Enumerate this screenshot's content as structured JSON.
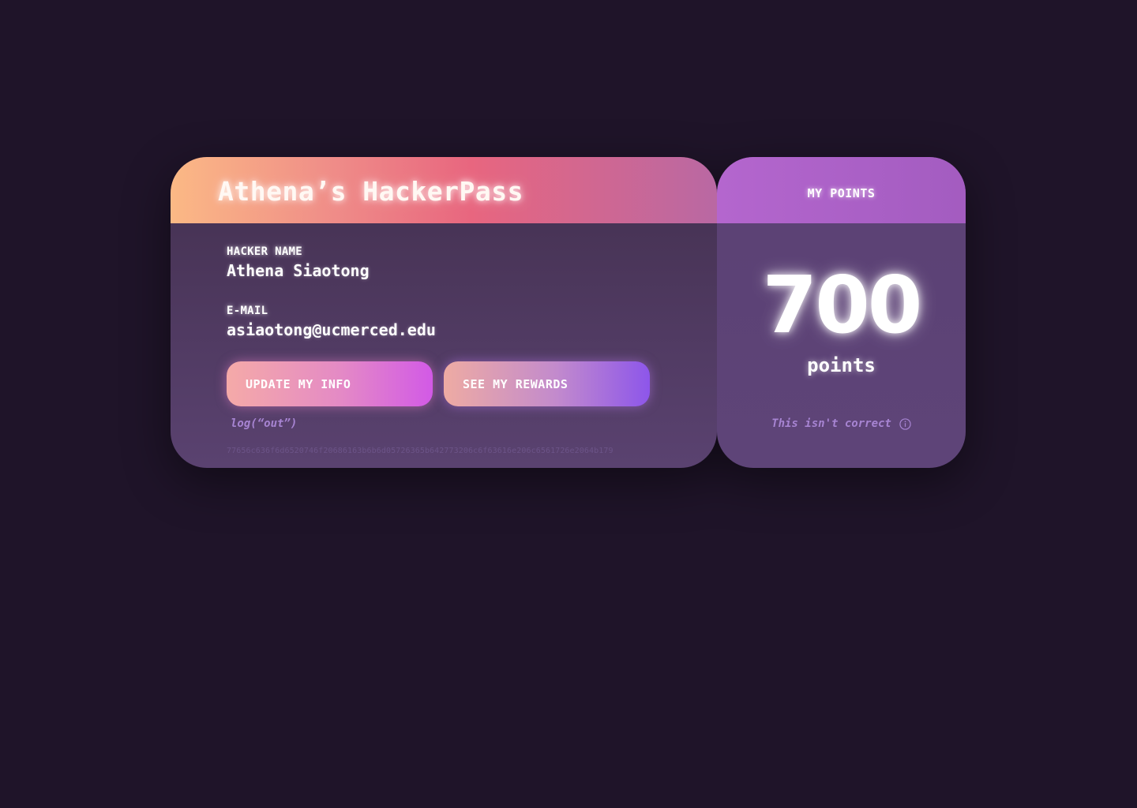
{
  "pass": {
    "title": "Athena’s HackerPass",
    "fields": {
      "name_label": "HACKER NAME",
      "name_value": "Athena Siaotong",
      "email_label": "E-MAIL",
      "email_value": "asiaotong@ucmerced.edu"
    },
    "buttons": {
      "update_label": "UPDATE MY INFO",
      "rewards_label": "SEE MY REWARDS"
    },
    "logout_label": "log(“out”)",
    "hash": "77656c636f6d6520746f20686163b6b6d05726365b642773206c6f63616e206c6561726e2064b179"
  },
  "points": {
    "title": "MY POINTS",
    "value": "700",
    "unit": "points",
    "incorrect_label": "This isn't correct",
    "incorrect_icon": "info-icon"
  },
  "colors": {
    "background": "#1f1429",
    "accent_text": "#a784d2"
  }
}
